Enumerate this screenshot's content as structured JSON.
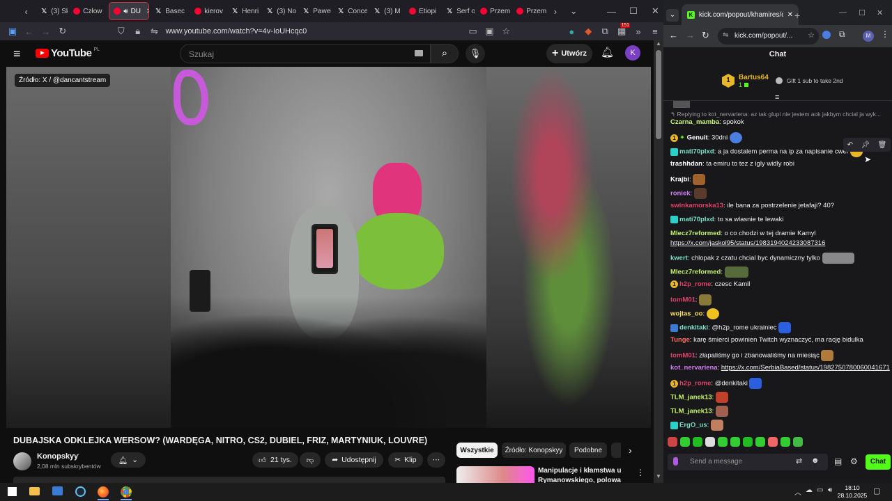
{
  "browser": {
    "tabs": [
      {
        "label": "(3) Sk",
        "icon": "x-icon"
      },
      {
        "label": "Człow",
        "icon": "youtube-icon"
      },
      {
        "label": "DU",
        "icon": "youtube-icon",
        "active": true
      },
      {
        "label": "Basec",
        "icon": "x-icon"
      },
      {
        "label": "kierov",
        "icon": "youtube-icon"
      },
      {
        "label": "Henri",
        "icon": "x-icon"
      },
      {
        "label": "(3) No",
        "icon": "x-icon"
      },
      {
        "label": "Paweł",
        "icon": "x-icon"
      },
      {
        "label": "Conce",
        "icon": "x-icon"
      },
      {
        "label": "(3) M",
        "icon": "x-icon"
      },
      {
        "label": "Etiopi",
        "icon": "youtube-icon"
      },
      {
        "label": "Serf o",
        "icon": "x-icon"
      },
      {
        "label": "Przem",
        "icon": "youtube-icon"
      },
      {
        "label": "Przem",
        "icon": "youtube-icon"
      }
    ],
    "url": "www.youtube.com/watch?v=4v-IoUHcqc0",
    "ext_count": "151"
  },
  "youtube": {
    "logo_text": "YouTube",
    "logo_region": "PL",
    "search_placeholder": "Szukaj",
    "create_label": "Utwórz",
    "avatar_letter": "K",
    "video_source_label": "Źródło: X / @dancantstream",
    "video_title": "DUBAJSKA ODKLEJKA WERSOW? (WARDĘGA, NITRO, CS2, DUBIEL, FRIZ, MARTYNIUK, LOUVRE)",
    "channel_name": "Konopskyy",
    "subscribers": "2,08 mln subskrybentów",
    "likes": "21 tys.",
    "share_label": "Udostępnij",
    "clip_label": "Klip",
    "chips": [
      "Wszystkie",
      "Źródło: Konopskyy",
      "Podobne"
    ],
    "related_title_1": "Manipulacje i kłamstwa u",
    "related_title_2": "Rymanowskiego, polowa"
  },
  "kick": {
    "url": "kick.com/popout/...",
    "tab_title": "kick.com/popout/khamires/cha",
    "chat_title": "Chat",
    "gifter_name": "Bartus64",
    "gifter_count": "1",
    "gift_text": "Gift 1 sub to take 2nd",
    "reply_text": "Replying to kot_nervariena: az tak glupi nie jestem aok jakbym chcial ja wyk...",
    "messages": [
      {
        "user": "Czarna_mamba",
        "text": "spokok",
        "color": "#c6f36b"
      },
      {
        "user": "Genuit",
        "text": "30dni",
        "color": "#ffffff"
      },
      {
        "user": "mati70plxd",
        "text": "a ja dostalem perma na ip za napisanie cwel",
        "color": "#7be0c5"
      },
      {
        "user": "trashhdan",
        "text": "ta emiru to tez z igly widly robi",
        "color": "#ffffff"
      },
      {
        "user": "Krajbi",
        "text": "",
        "color": "#ffffff"
      },
      {
        "user": "roniek",
        "text": "",
        "color": "#d07cf5"
      },
      {
        "user": "swinkamorska13",
        "text": "ile bana za postrzelenie jetafaji? 40?",
        "color": "#e0416a"
      },
      {
        "user": "mati70plxd",
        "text": "to sa wlasnie te lewaki",
        "color": "#7be0c5"
      },
      {
        "user": "Mlecz7reformed",
        "text": "o co chodzi w tej dramie Kamyl",
        "color": "#c6f36b"
      },
      {
        "user": "",
        "text": "https://x.com/jaskol95/status/1983194024233087316",
        "color": "#ffffff"
      },
      {
        "user": "kwert",
        "text": "chlopak z czatu chcial byc dynamiczny tylko",
        "color": "#7be0c5"
      },
      {
        "user": "Mlecz7reformed",
        "text": "",
        "color": "#c6f36b"
      },
      {
        "user": "h2p_rome",
        "text": "czesc Kamil",
        "color": "#e0416a"
      },
      {
        "user": "tomM01",
        "text": "",
        "color": "#e0416a"
      },
      {
        "user": "wojtas_oo",
        "text": "",
        "color": "#ffe066"
      },
      {
        "user": "denkitaki",
        "text": "@h2p_rome ukrainiec",
        "color": "#7be0c5"
      },
      {
        "user": "Tunge",
        "text": "karę śmierci powinien Twitch wyznaczyć, ma rację bidulka",
        "color": "#ff6a5a"
      },
      {
        "user": "tomM01",
        "text": "złapaliśmy go i zbanowaliśmy na miesiąc",
        "color": "#e0416a"
      },
      {
        "user": "kot_nervariena",
        "text": "https://x.com/SerbiaBased/status/1982750780060041671",
        "color": "#d07cf5"
      },
      {
        "user": "h2p_rome",
        "text": "@denkitaki",
        "color": "#e0416a"
      },
      {
        "user": "TLM_janek13",
        "text": "",
        "color": "#c6f36b"
      },
      {
        "user": "TLM_janek13",
        "text": "",
        "color": "#c6f36b"
      },
      {
        "user": "ErgO_us",
        "text": "",
        "color": "#7be0c5"
      }
    ],
    "input_placeholder": "Send a message",
    "send_label": "Chat"
  },
  "taskbar": {
    "time": "18:10",
    "date": "28.10.2025"
  }
}
